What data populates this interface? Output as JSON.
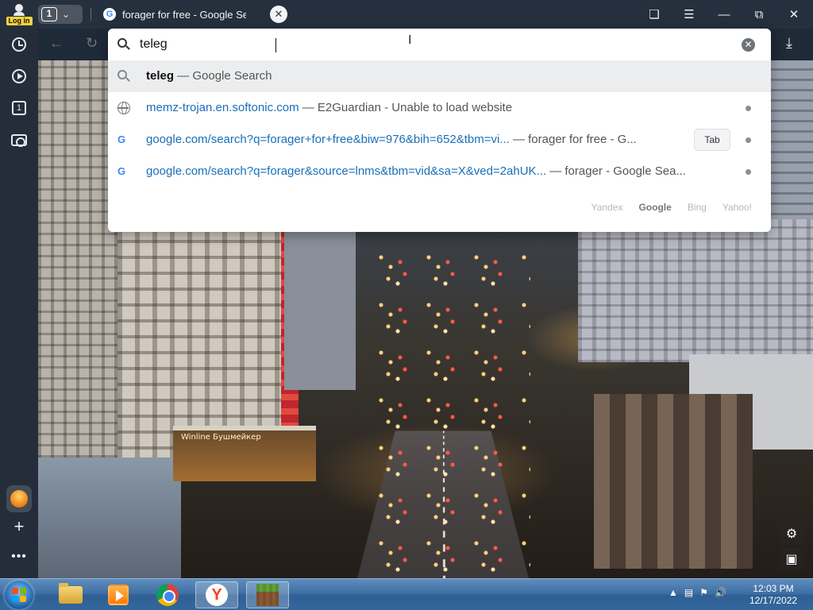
{
  "browser": {
    "login_label": "Log in",
    "tab_count": "1",
    "tab_title": "forager for free - Google Se",
    "favicon_letter": "G"
  },
  "omnibox": {
    "query": "teleg",
    "suggestions": [
      {
        "bold": "teleg",
        "rest": " — Google Search",
        "icon": "search-icon"
      },
      {
        "url": "memz-trojan.en.softonic.com",
        "desc": " — E2Guardian - Unable to load website",
        "icon": "globe-icon"
      },
      {
        "url": "google.com/search?q=forager+for+free&biw=976&bih=652&tbm=vi...",
        "desc": " — forager for free - G...",
        "icon": "google-icon",
        "badge": "Tab"
      },
      {
        "url": "google.com/search?q=forager&source=lnms&tbm=vid&sa=X&ved=2ahUK...",
        "desc": " — forager - Google Sea...",
        "icon": "google-icon"
      }
    ],
    "engines": [
      "Yandex",
      "Google",
      "Bing",
      "Yahoo!"
    ],
    "active_engine": "Google"
  },
  "wallpaper": {
    "shop_sign": "Winline  Бушмейкер"
  },
  "taskbar": {
    "time": "12:03 PM",
    "date": "12/17/2022",
    "yandex_letter": "Y"
  },
  "colors": {
    "link_blue": "#1a6fb8",
    "selected_row": "#ecedef",
    "taskbar_blue": "#3d6ea3"
  }
}
